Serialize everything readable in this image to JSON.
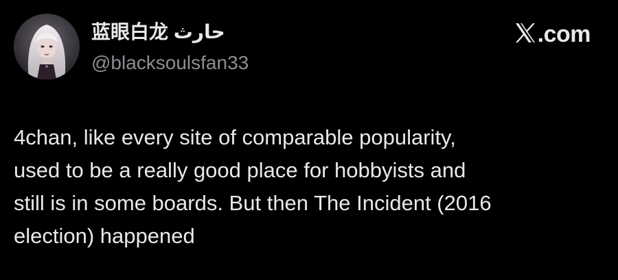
{
  "author": {
    "display_name": "蓝眼白龙 حارث",
    "handle": "@blacksoulsfan33",
    "avatar_icon": "profile-avatar-image"
  },
  "brand": {
    "logo_icon": "x-logo-icon",
    "text": ".com"
  },
  "tweet": {
    "text": "4chan, like every site of comparable popularity,\nused to be a really good place for hobbyists and\nstill is in some boards. But then The Incident (2016\nelection) happened"
  },
  "colors": {
    "background": "#000000",
    "primary_text": "#e7e9ea",
    "secondary_text": "#8b8f94"
  }
}
